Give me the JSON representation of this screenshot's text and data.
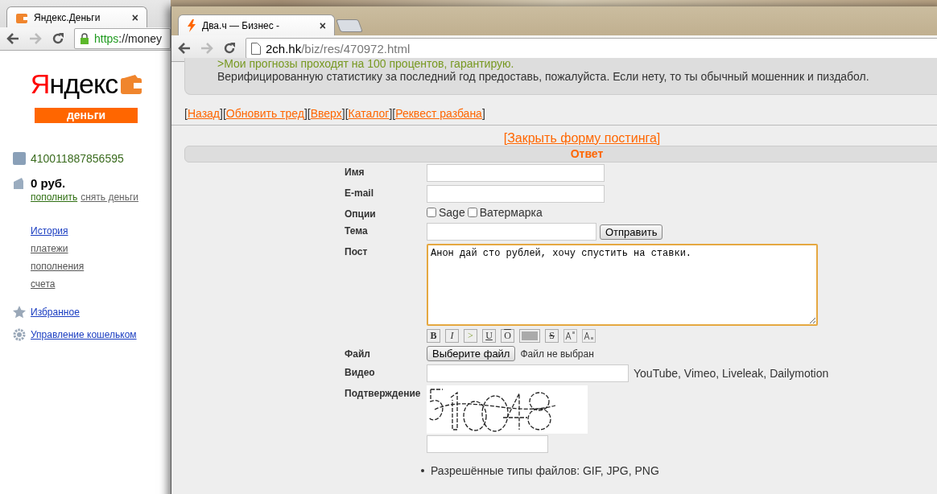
{
  "left_window": {
    "tab_title": "Яндекс.Деньги",
    "tab_close": "×",
    "url_scheme": "https",
    "url_rest": "://money",
    "logo": {
      "word": "Яндекс",
      "badge": "деньги"
    },
    "account": "410011887856595",
    "balance": "0 руб.",
    "balance_actions": [
      {
        "label": "пополнить",
        "kind": "green"
      },
      {
        "label": "снять деньги",
        "kind": "grey"
      }
    ],
    "history_link": "История",
    "history_items": [
      "платежи",
      "пополнения",
      "счета"
    ],
    "bottom_links": [
      {
        "label": "Избранное",
        "kind": "star"
      },
      {
        "label": "Управление кошельком",
        "kind": "gear"
      }
    ]
  },
  "right_window": {
    "tab_title": "Два.ч — Бизнес -",
    "tab_close": "×",
    "url_host": "2ch.hk",
    "url_path": "/biz/res/470972.html",
    "post": {
      "quote": ">Мои прогнозы проходят на 100 процентов, гарантирую.",
      "text": "Верифицированную статистику за последний год предоставь, пожалуйста. Если нету, то ты обычный мошенник и пиздабол."
    },
    "nav": {
      "bracket_open": "[",
      "bracket_close": "]",
      "items": [
        "Назад",
        "Обновить тред",
        "Вверх",
        "Каталог",
        "Реквест разбана"
      ]
    },
    "close_form": "[Закрыть форму постинга]",
    "form_title": "Ответ",
    "form_rows": [
      {
        "kind": "text",
        "label": "Имя"
      },
      {
        "kind": "text",
        "label": "E-mail"
      },
      {
        "kind": "checkboxes",
        "label": "Опции",
        "options": [
          {
            "label": "Sage",
            "checked": false
          },
          {
            "label": "Ватермарка",
            "checked": false
          }
        ]
      },
      {
        "kind": "text_button",
        "label": "Тема",
        "button": "Отправить"
      },
      {
        "kind": "textarea",
        "label": "Пост",
        "value": "Анон дай сто рублей, хочу спустить на ставки."
      },
      {
        "kind": "toolbar",
        "buttons": [
          {
            "kind": "bold",
            "label": "B"
          },
          {
            "kind": "italic",
            "label": "I"
          },
          {
            "kind": "quote",
            "label": ">"
          },
          {
            "kind": "underline",
            "label": "U"
          },
          {
            "kind": "overline",
            "label": "O"
          },
          {
            "kind": "spoiler"
          },
          {
            "kind": "strike",
            "label": "S"
          },
          {
            "kind": "sup"
          },
          {
            "kind": "sub"
          }
        ]
      },
      {
        "kind": "file",
        "label": "Файл",
        "button": "Выберите файл",
        "status": "Файл не выбран"
      },
      {
        "kind": "text_note",
        "label": "Видео",
        "note": "YouTube, Vimeo, Liveleak, Dailymotion"
      },
      {
        "kind": "captcha",
        "label": "Подтверждение"
      }
    ],
    "allowed_types": "Разрешённые типы файлов: GIF, JPG, PNG"
  }
}
